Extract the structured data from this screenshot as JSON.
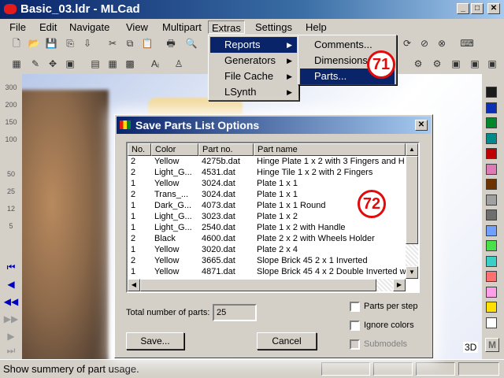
{
  "window": {
    "title": "Basic_03.ldr - MLCad"
  },
  "menubar": [
    "File",
    "Edit",
    "Navigate",
    "View",
    "Multipart",
    "Extras",
    "Settings",
    "Help"
  ],
  "extras_menu": [
    "Reports",
    "Generators",
    "File Cache",
    "LSynth"
  ],
  "reports_submenu": [
    "Comments...",
    "Dimensions...",
    "Parts..."
  ],
  "annotations": {
    "a": "71",
    "b": "72"
  },
  "left_tools": [
    "300",
    "200",
    "150",
    "100",
    "50",
    "25",
    "12",
    "5"
  ],
  "color_swatches": [
    "#1b1b1b",
    "#0b2fb5",
    "#00862b",
    "#008a8a",
    "#c00000",
    "#e07ab6",
    "#6c3200",
    "#a0a0a0",
    "#6e6e6e",
    "#6fa0ff",
    "#4ae04a",
    "#3ad0c8",
    "#ff7070",
    "#ff9ee8",
    "#ffe000",
    "#ffffff"
  ],
  "dialog": {
    "title": "Save Parts List Options",
    "columns": [
      "No.",
      "Color",
      "Part no.",
      "Part name"
    ],
    "rows": [
      [
        "2",
        "Yellow",
        "4275b.dat",
        "Hinge Plate  1 x  2 with 3 Fingers and H"
      ],
      [
        "2",
        "Light_G...",
        "4531.dat",
        "Hinge Tile  1 x  2 with 2 Fingers"
      ],
      [
        "1",
        "Yellow",
        "3024.dat",
        "Plate  1 x  1"
      ],
      [
        "2",
        "Trans_...",
        "3024.dat",
        "Plate  1 x  1"
      ],
      [
        "1",
        "Dark_G...",
        "4073.dat",
        "Plate  1 x  1 Round"
      ],
      [
        "1",
        "Light_G...",
        "3023.dat",
        "Plate  1 x  2"
      ],
      [
        "1",
        "Light_G...",
        "2540.dat",
        "Plate  1 x  2 with Handle"
      ],
      [
        "2",
        "Black",
        "4600.dat",
        "Plate  2 x  2 with Wheels Holder"
      ],
      [
        "1",
        "Yellow",
        "3020.dat",
        "Plate  2 x  4"
      ],
      [
        "2",
        "Yellow",
        "3665.dat",
        "Slope Brick 45  2 x  1 Inverted"
      ],
      [
        "1",
        "Yellow",
        "4871.dat",
        "Slope Brick 45  4 x  2 Double Inverted w"
      ]
    ],
    "total_label": "Total number of parts:",
    "total_value": "25",
    "save_label": "Save...",
    "cancel_label": "Cancel",
    "options": [
      "Parts per step",
      "Ignore colors",
      "Submodels"
    ]
  },
  "status": {
    "text": "Show summery of part usage."
  },
  "labels3d": {
    "three_d": "3D",
    "m": "M"
  }
}
